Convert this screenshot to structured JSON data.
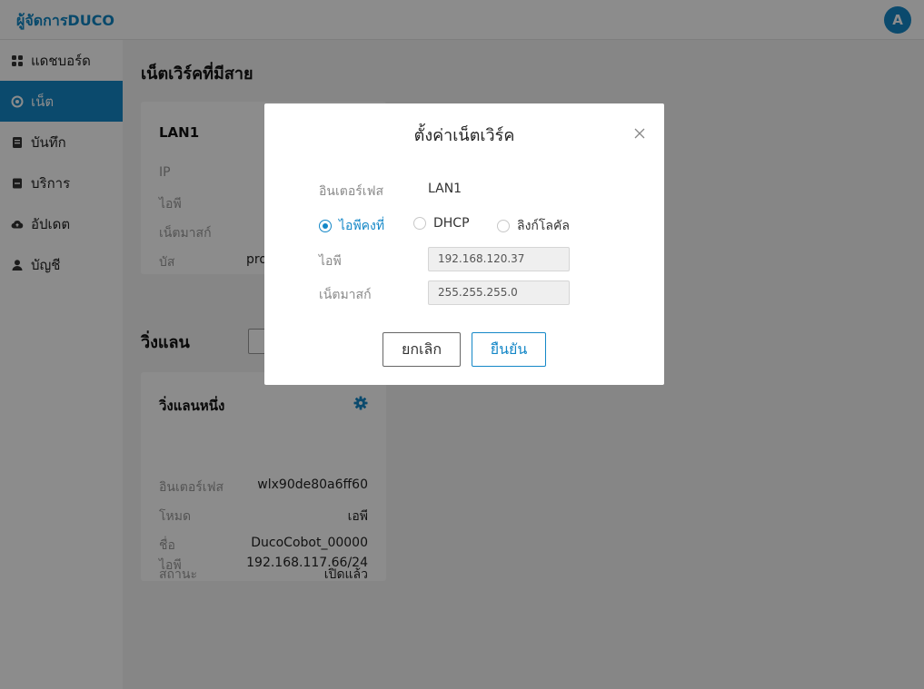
{
  "app": {
    "title": "ผู้จัดการDUCO",
    "avatar_letter": "A"
  },
  "sidebar": {
    "items": [
      {
        "label": "แดชบอร์ด",
        "icon": "dashboard-icon"
      },
      {
        "label": "เน็ต",
        "icon": "network-icon",
        "active": true
      },
      {
        "label": "บันทึก",
        "icon": "log-icon"
      },
      {
        "label": "บริการ",
        "icon": "service-icon"
      },
      {
        "label": "อัปเดต",
        "icon": "cloud-icon"
      },
      {
        "label": "บัญชี",
        "icon": "user-icon"
      }
    ]
  },
  "main": {
    "wired_heading": "เน็ตเวิร์คที่มีสาย",
    "lan_card": {
      "title": "LAN1",
      "rows": [
        {
          "label": "IP",
          "value": ""
        },
        {
          "label": "ไอพี",
          "value": ""
        },
        {
          "label": "เน็ตมาสก์",
          "value": ""
        },
        {
          "label": "บัส",
          "value": "pro"
        }
      ]
    },
    "wlan_heading": "วิ่งแลน",
    "wlan_card": {
      "title": "วิ่งแลนหนึ่ง",
      "rows": [
        {
          "label": "อินเตอร์เฟส",
          "value": "wlx90de80a6ff60"
        },
        {
          "label": "โหมด",
          "value": "เอพี"
        },
        {
          "label": "ชื่อ",
          "value": "DucoCobot_00000"
        },
        {
          "label": "สถานะ",
          "value": "เปิดแล้ว"
        },
        {
          "label": "ไอพี",
          "value": "192.168.117.66/24"
        }
      ]
    }
  },
  "modal": {
    "title": "ตั้งค่าเน็ตเวิร์ค",
    "interface_label": "อินเตอร์เฟส",
    "interface_value": "LAN1",
    "radios": [
      {
        "label": "ไอพีคงที่",
        "checked": true
      },
      {
        "label": "DHCP",
        "checked": false
      },
      {
        "label": "ลิงก์โลคัล",
        "checked": false
      }
    ],
    "ip_label": "ไอพี",
    "ip_value": "192.168.120.37",
    "netmask_label": "เน็ตมาสก์",
    "netmask_value": "255.255.255.0",
    "cancel_label": "ยกเลิก",
    "confirm_label": "ยืนยัน"
  },
  "colors": {
    "accent": "#1487c7",
    "overlay": "rgba(0,0,0,0.45)"
  }
}
